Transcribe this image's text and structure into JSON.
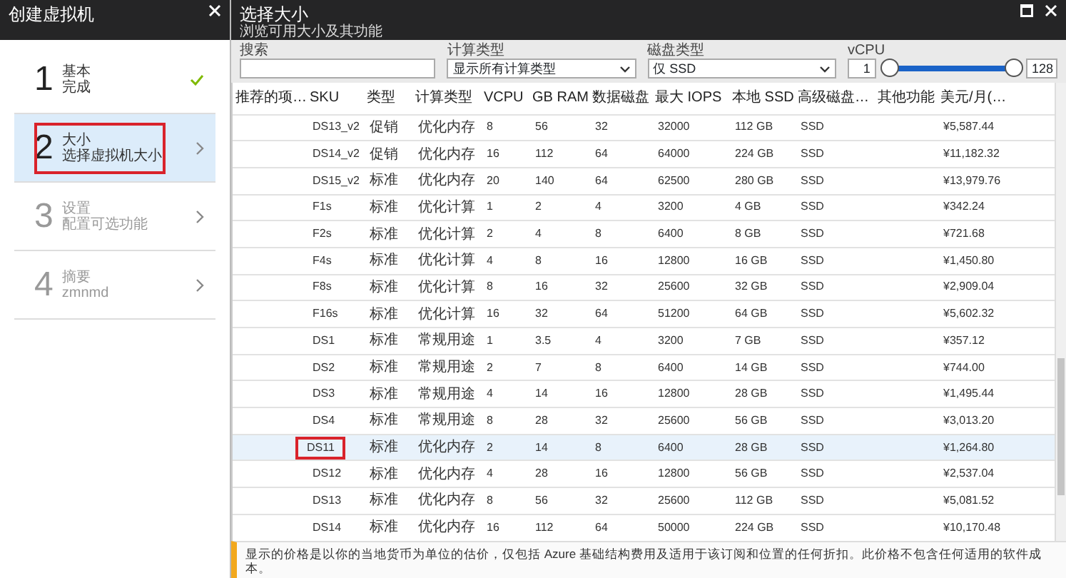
{
  "left_blade": {
    "title": "创建虚拟机",
    "steps": [
      {
        "number": "1",
        "title": "基本",
        "subtitle": "完成",
        "completed": true,
        "selected": false,
        "disabled": false,
        "highlighted": false
      },
      {
        "number": "2",
        "title": "大小",
        "subtitle": "选择虚拟机大小",
        "completed": false,
        "selected": true,
        "disabled": false,
        "highlighted": true
      },
      {
        "number": "3",
        "title": "设置",
        "subtitle": "配置可选功能",
        "completed": false,
        "selected": false,
        "disabled": true,
        "highlighted": false
      },
      {
        "number": "4",
        "title": "摘要",
        "subtitle": "zmnmd",
        "completed": false,
        "selected": false,
        "disabled": true,
        "highlighted": false
      }
    ]
  },
  "right_blade": {
    "title": "选择大小",
    "subtitle": "浏览可用大小及其功能",
    "filters": {
      "search": {
        "label": "搜索"
      },
      "compute_type": {
        "label": "计算类型",
        "value": "显示所有计算类型"
      },
      "disk_type": {
        "label": "磁盘类型",
        "value": "仅 SSD"
      },
      "vcpu": {
        "label": "vCPU",
        "min": "1",
        "max": "128",
        "level": 1
      }
    },
    "table": {
      "columns": [
        "推荐的项…",
        "SKU",
        "类型",
        "计算类型",
        "VCPU",
        "GB RAM",
        "数据磁盘",
        "最大 IOPS",
        "本地 SSD",
        "高级磁盘…",
        "其他功能",
        "美元/月(…"
      ],
      "rows": [
        {
          "sku": "DS13_v2",
          "type": "促销",
          "compute": "优化内存",
          "vcpu": "8",
          "ram": "56",
          "disks": "32",
          "iops": "32000",
          "ssd": "112 GB",
          "premium": "SSD",
          "price": "¥5,587.44",
          "selected": false
        },
        {
          "sku": "DS14_v2",
          "type": "促销",
          "compute": "优化内存",
          "vcpu": "16",
          "ram": "112",
          "disks": "64",
          "iops": "64000",
          "ssd": "224 GB",
          "premium": "SSD",
          "price": "¥11,182.32",
          "selected": false
        },
        {
          "sku": "DS15_v2",
          "type": "标准",
          "compute": "优化内存",
          "vcpu": "20",
          "ram": "140",
          "disks": "64",
          "iops": "62500",
          "ssd": "280 GB",
          "premium": "SSD",
          "price": "¥13,979.76",
          "selected": false
        },
        {
          "sku": "F1s",
          "type": "标准",
          "compute": "优化计算",
          "vcpu": "1",
          "ram": "2",
          "disks": "4",
          "iops": "3200",
          "ssd": "4 GB",
          "premium": "SSD",
          "price": "¥342.24",
          "selected": false
        },
        {
          "sku": "F2s",
          "type": "标准",
          "compute": "优化计算",
          "vcpu": "2",
          "ram": "4",
          "disks": "8",
          "iops": "6400",
          "ssd": "8 GB",
          "premium": "SSD",
          "price": "¥721.68",
          "selected": false
        },
        {
          "sku": "F4s",
          "type": "标准",
          "compute": "优化计算",
          "vcpu": "4",
          "ram": "8",
          "disks": "16",
          "iops": "12800",
          "ssd": "16 GB",
          "premium": "SSD",
          "price": "¥1,450.80",
          "selected": false
        },
        {
          "sku": "F8s",
          "type": "标准",
          "compute": "优化计算",
          "vcpu": "8",
          "ram": "16",
          "disks": "32",
          "iops": "25600",
          "ssd": "32 GB",
          "premium": "SSD",
          "price": "¥2,909.04",
          "selected": false
        },
        {
          "sku": "F16s",
          "type": "标准",
          "compute": "优化计算",
          "vcpu": "16",
          "ram": "32",
          "disks": "64",
          "iops": "51200",
          "ssd": "64 GB",
          "premium": "SSD",
          "price": "¥5,602.32",
          "selected": false
        },
        {
          "sku": "DS1",
          "type": "标准",
          "compute": "常规用途",
          "vcpu": "1",
          "ram": "3.5",
          "disks": "4",
          "iops": "3200",
          "ssd": "7 GB",
          "premium": "SSD",
          "price": "¥357.12",
          "selected": false
        },
        {
          "sku": "DS2",
          "type": "标准",
          "compute": "常规用途",
          "vcpu": "2",
          "ram": "7",
          "disks": "8",
          "iops": "6400",
          "ssd": "14 GB",
          "premium": "SSD",
          "price": "¥744.00",
          "selected": false
        },
        {
          "sku": "DS3",
          "type": "标准",
          "compute": "常规用途",
          "vcpu": "4",
          "ram": "14",
          "disks": "16",
          "iops": "12800",
          "ssd": "28 GB",
          "premium": "SSD",
          "price": "¥1,495.44",
          "selected": false
        },
        {
          "sku": "DS4",
          "type": "标准",
          "compute": "常规用途",
          "vcpu": "8",
          "ram": "28",
          "disks": "32",
          "iops": "25600",
          "ssd": "56 GB",
          "premium": "SSD",
          "price": "¥3,013.20",
          "selected": false
        },
        {
          "sku": "DS11",
          "type": "标准",
          "compute": "优化内存",
          "vcpu": "2",
          "ram": "14",
          "disks": "8",
          "iops": "6400",
          "ssd": "28 GB",
          "premium": "SSD",
          "price": "¥1,264.80",
          "selected": true
        },
        {
          "sku": "DS12",
          "type": "标准",
          "compute": "优化内存",
          "vcpu": "4",
          "ram": "28",
          "disks": "16",
          "iops": "12800",
          "ssd": "56 GB",
          "premium": "SSD",
          "price": "¥2,537.04",
          "selected": false
        },
        {
          "sku": "DS13",
          "type": "标准",
          "compute": "优化内存",
          "vcpu": "8",
          "ram": "56",
          "disks": "32",
          "iops": "25600",
          "ssd": "112 GB",
          "premium": "SSD",
          "price": "¥5,081.52",
          "selected": false
        },
        {
          "sku": "DS14",
          "type": "标准",
          "compute": "优化内存",
          "vcpu": "16",
          "ram": "112",
          "disks": "64",
          "iops": "50000",
          "ssd": "224 GB",
          "premium": "SSD",
          "price": "¥10,170.48",
          "selected": false
        }
      ]
    },
    "footer_note": "显示的价格是以你的当地货币为单位的估价，仅包括 Azure 基础结构费用及适用于该订阅和位置的任何折扣。此价格不包含任何适用的软件成本。"
  }
}
